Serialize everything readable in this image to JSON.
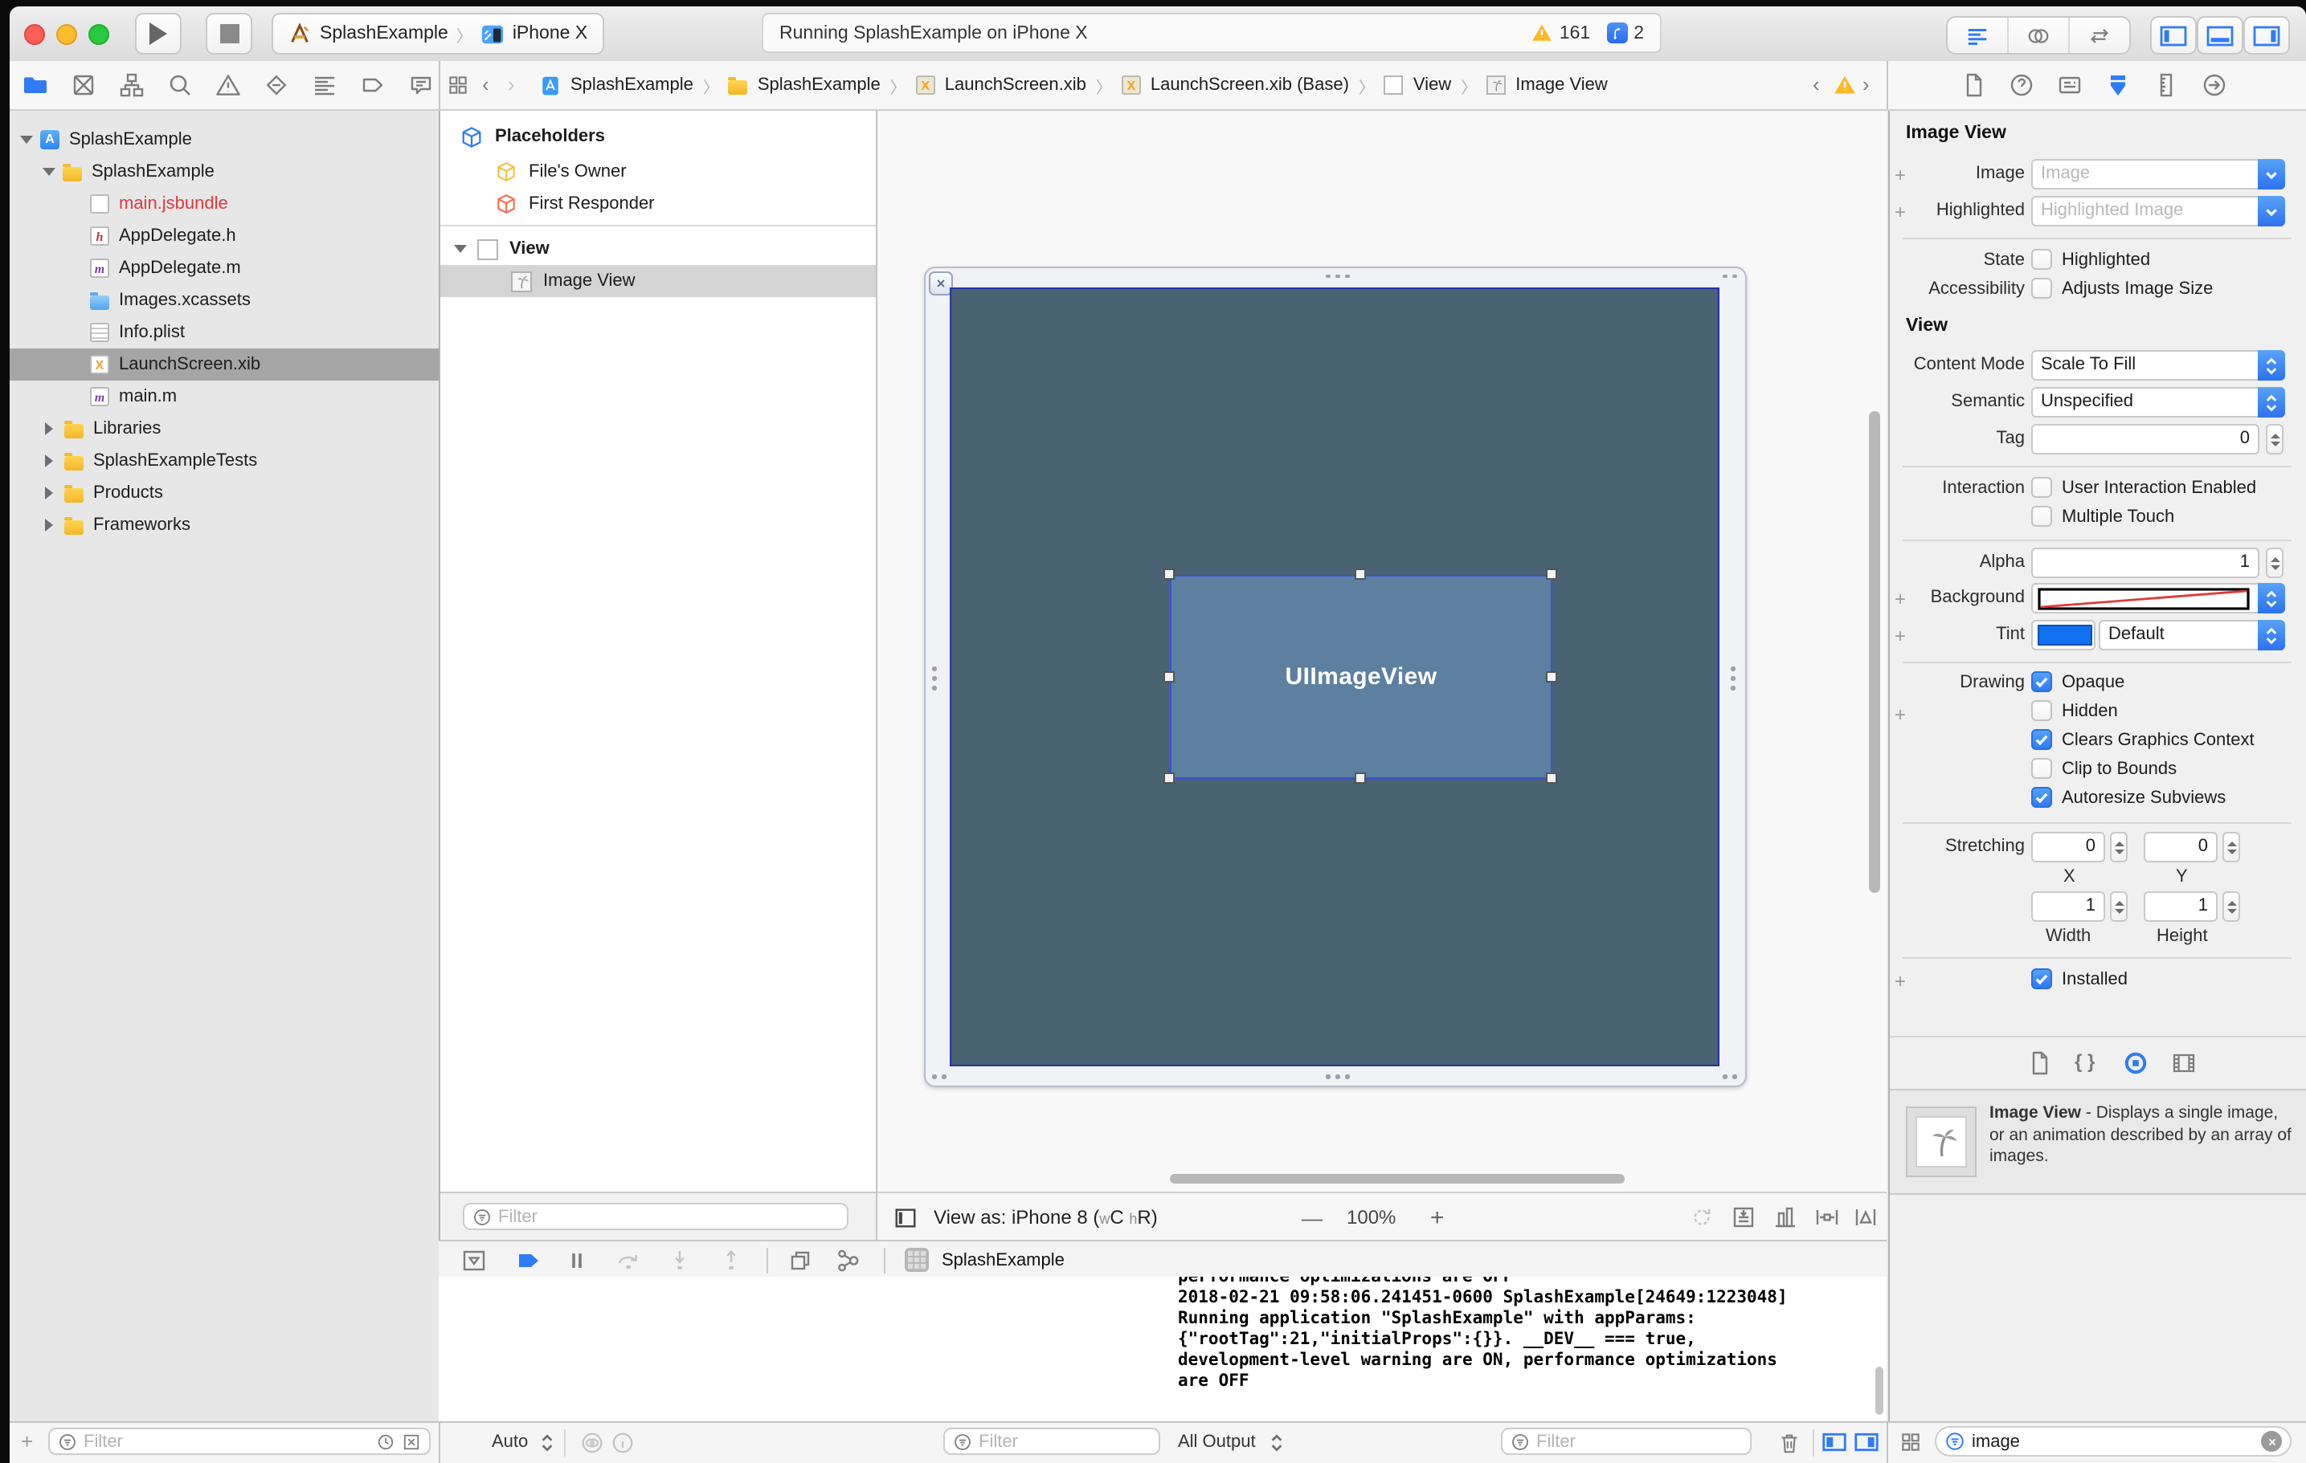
{
  "toolbar": {
    "scheme_target": "SplashExample",
    "scheme_device": "iPhone X",
    "status_text": "Running SplashExample on iPhone X",
    "warning_count": "161",
    "issue_count": "2"
  },
  "jumpbar": {
    "crumbs": [
      "SplashExample",
      "SplashExample",
      "LaunchScreen.xib",
      "LaunchScreen.xib (Base)",
      "View",
      "Image View"
    ]
  },
  "navigator": {
    "files": [
      {
        "label": "SplashExample"
      },
      {
        "label": "SplashExample"
      },
      {
        "label": "main.jsbundle"
      },
      {
        "label": "AppDelegate.h"
      },
      {
        "label": "AppDelegate.m"
      },
      {
        "label": "Images.xcassets"
      },
      {
        "label": "Info.plist"
      },
      {
        "label": "LaunchScreen.xib"
      },
      {
        "label": "main.m"
      },
      {
        "label": "Libraries"
      },
      {
        "label": "SplashExampleTests"
      },
      {
        "label": "Products"
      },
      {
        "label": "Frameworks"
      }
    ],
    "filter_placeholder": "Filter"
  },
  "outline": {
    "placeholders_label": "Placeholders",
    "files_owner": "File's Owner",
    "first_responder": "First Responder",
    "view_label": "View",
    "image_view_label": "Image View",
    "filter_placeholder": "Filter"
  },
  "canvas": {
    "selection_label": "UIImageView",
    "view_as_prefix": "View as: iPhone 8 (",
    "w_small": "w",
    "w_class": "C",
    "h_small": "h",
    "h_class": "R",
    "view_as_suffix": ")",
    "zoom_out": "—",
    "zoom_value": "100%",
    "zoom_in": "+"
  },
  "inspector": {
    "section_image_view": {
      "title": "Image View",
      "image_label": "Image",
      "image_placeholder": "Image",
      "highlighted_label": "Highlighted",
      "highlighted_placeholder": "Highlighted Image",
      "state_label": "State",
      "state_option": "Highlighted",
      "accessibility_label": "Accessibility",
      "accessibility_option": "Adjusts Image Size"
    },
    "section_view": {
      "title": "View",
      "content_mode_label": "Content Mode",
      "content_mode_value": "Scale To Fill",
      "semantic_label": "Semantic",
      "semantic_value": "Unspecified",
      "tag_label": "Tag",
      "tag_value": "0",
      "interaction_label": "Interaction",
      "interaction_option1": "User Interaction Enabled",
      "interaction_option2": "Multiple Touch",
      "alpha_label": "Alpha",
      "alpha_value": "1",
      "background_label": "Background",
      "tint_label": "Tint",
      "tint_value": "Default",
      "drawing_label": "Drawing",
      "drawing_options": [
        "Opaque",
        "Hidden",
        "Clears Graphics Context",
        "Clip to Bounds",
        "Autoresize Subviews"
      ],
      "stretching_label": "Stretching",
      "stretch_x": "0",
      "stretch_y": "0",
      "stretch_width": "1",
      "stretch_height": "1",
      "x_label": "X",
      "y_label": "Y",
      "width_label": "Width",
      "height_label": "Height",
      "installed_label": "Installed"
    }
  },
  "library": {
    "item_title": "Image View",
    "item_description": "- Displays a single image, or an animation described by an array of images.",
    "search_value": "image"
  },
  "debug": {
    "bar_app_label": "SplashExample",
    "variables_scope": "Auto",
    "variables_filter_placeholder": "Filter",
    "console_scope": "All Output",
    "console_filter_placeholder": "Filter",
    "console_lines": [
      "performance optimizations are OFF",
      "2018-02-21 09:58:06.241451-0600 SplashExample[24649:1223048]",
      "Running application \"SplashExample\" with appParams:",
      "{\"rootTag\":21,\"initialProps\":{}}. __DEV__ === true,",
      "development-level warning are ON, performance optimizations",
      "are OFF"
    ]
  },
  "colors": {
    "accent_blue": "#2f7cf6",
    "warning_yellow": "#fdb827",
    "screen_slate": "#4a6372",
    "imageview_blue": "#5d80a1",
    "file_red": "#e0383e"
  }
}
